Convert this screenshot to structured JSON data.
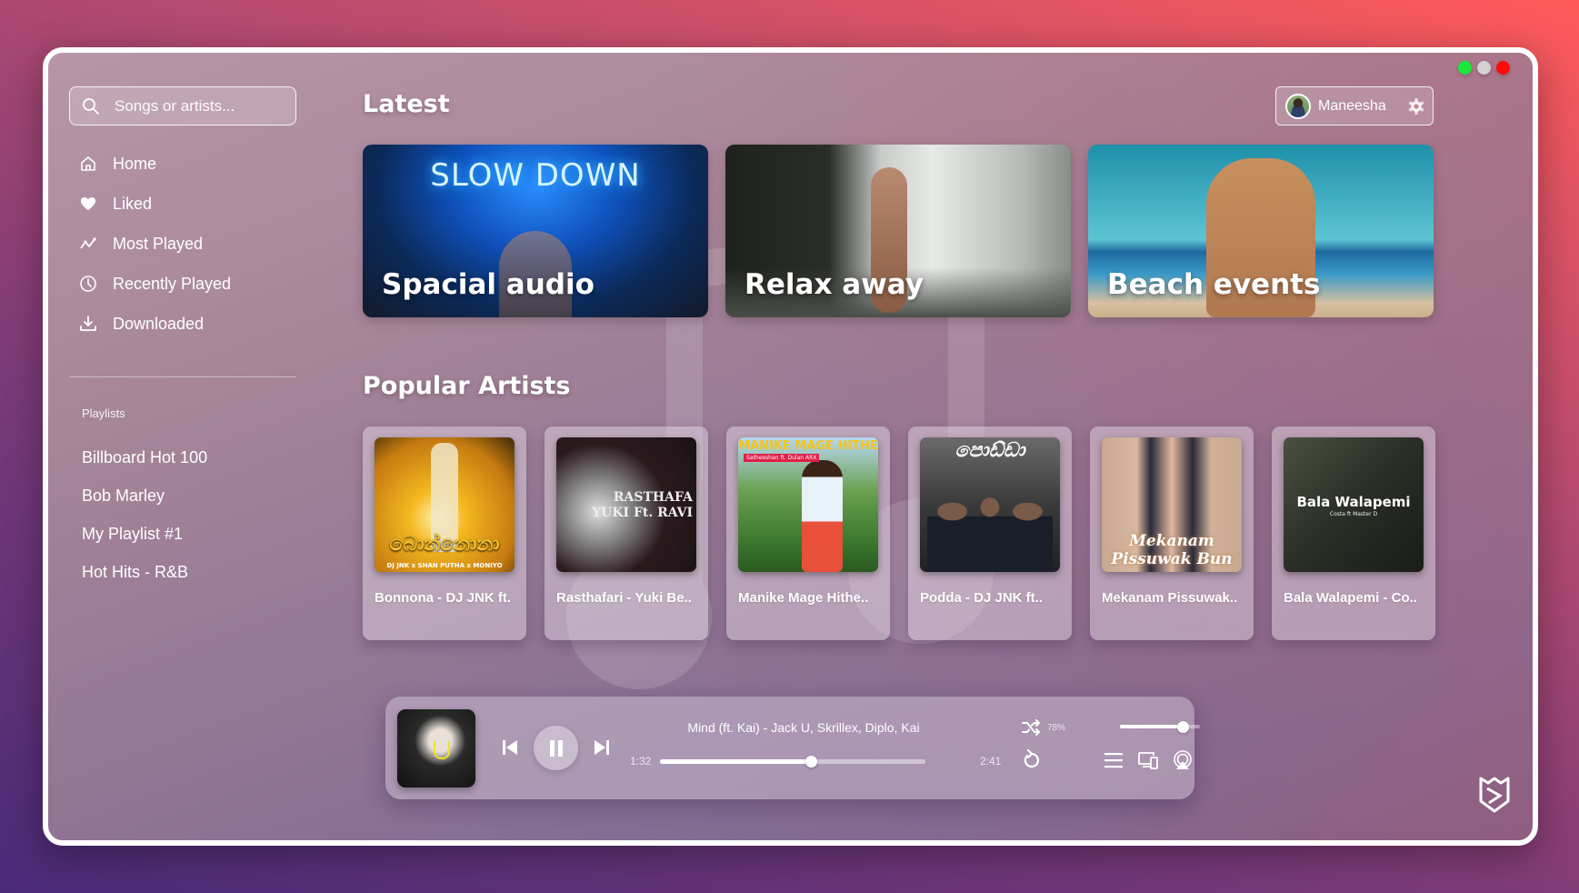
{
  "window": {
    "traffic_lights": [
      {
        "name": "maximize",
        "color": "#18e73c"
      },
      {
        "name": "minimize",
        "color": "#d2d2d2"
      },
      {
        "name": "close",
        "color": "#ff0a0a"
      }
    ]
  },
  "sidebar": {
    "search": {
      "placeholder": "Songs or artists...",
      "value": "",
      "icon": "search-icon"
    },
    "nav": [
      {
        "label": "Home",
        "icon": "home-icon"
      },
      {
        "label": "Liked",
        "icon": "heart-icon"
      },
      {
        "label": "Most Played",
        "icon": "trending-icon"
      },
      {
        "label": "Recently Played",
        "icon": "clock-icon"
      },
      {
        "label": "Downloaded",
        "icon": "download-icon"
      }
    ],
    "playlists_header": "Playlists",
    "playlists": [
      "Billboard Hot 100",
      "Bob Marley",
      "My Playlist #1",
      "Hot Hits - R&B"
    ]
  },
  "header": {
    "user": {
      "name": "Maneesha",
      "icon": "gear-icon"
    }
  },
  "main": {
    "latest_title": "Latest",
    "featured": [
      {
        "label": "Spacial audio",
        "art_text": "SLOW DOWN"
      },
      {
        "label": "Relax away"
      },
      {
        "label": "Beach events"
      }
    ],
    "popular_title": "Popular Artists",
    "artists": [
      {
        "label": "Bonnona - DJ JNK ft.",
        "art_text": "බොන්නොනා",
        "art_sub": "DJ JNK x SHAN PUTHA x MONIYO"
      },
      {
        "label": "Rasthafari - Yuki Be..",
        "art_text": "RASTHAFA\nYUKI Ft. RAVI"
      },
      {
        "label": "Manike Mage Hithe..",
        "art_text": "MANIKE MAGE HITHE",
        "art_sub": "Satheeshan ft. Dulan ARX"
      },
      {
        "label": "Podda - DJ JNK ft..",
        "art_text": "පොඩ්ඩා"
      },
      {
        "label": "Mekanam Pissuwak..",
        "art_text": "Mekanam Pissuwak Bun"
      },
      {
        "label": "Bala Walapemi - Co..",
        "art_text": "Bala Walapemi",
        "art_sub": "Costa ft Master D"
      }
    ]
  },
  "player": {
    "title": "Mind (ft. Kai) - Jack U, Skrillex, Diplo, Kai",
    "current_time": "1:32",
    "total_time": "2:41",
    "progress_fraction": 0.57,
    "volume_label": "78%",
    "volume_fraction": 0.78,
    "state": "playing"
  }
}
